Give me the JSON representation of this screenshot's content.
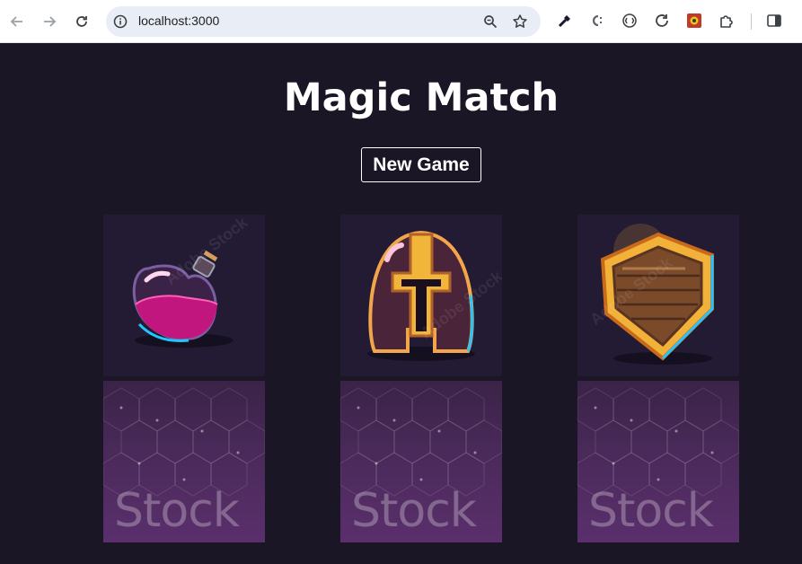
{
  "browser": {
    "url": "localhost:3000"
  },
  "page": {
    "title": "Magic Match",
    "new_game_label": "New Game"
  },
  "cards": [
    {
      "state": "revealed",
      "icon": "potion-icon"
    },
    {
      "state": "revealed",
      "icon": "helmet-icon"
    },
    {
      "state": "revealed",
      "icon": "shield-icon"
    },
    {
      "state": "hidden",
      "back_text": "Stock"
    },
    {
      "state": "hidden",
      "back_text": "Stock"
    },
    {
      "state": "hidden",
      "back_text": "Stock"
    }
  ],
  "colors": {
    "background": "#1b1625",
    "card_front_bg": "#231b33",
    "card_back": "#4a2a5a",
    "text": "#ffffff"
  }
}
